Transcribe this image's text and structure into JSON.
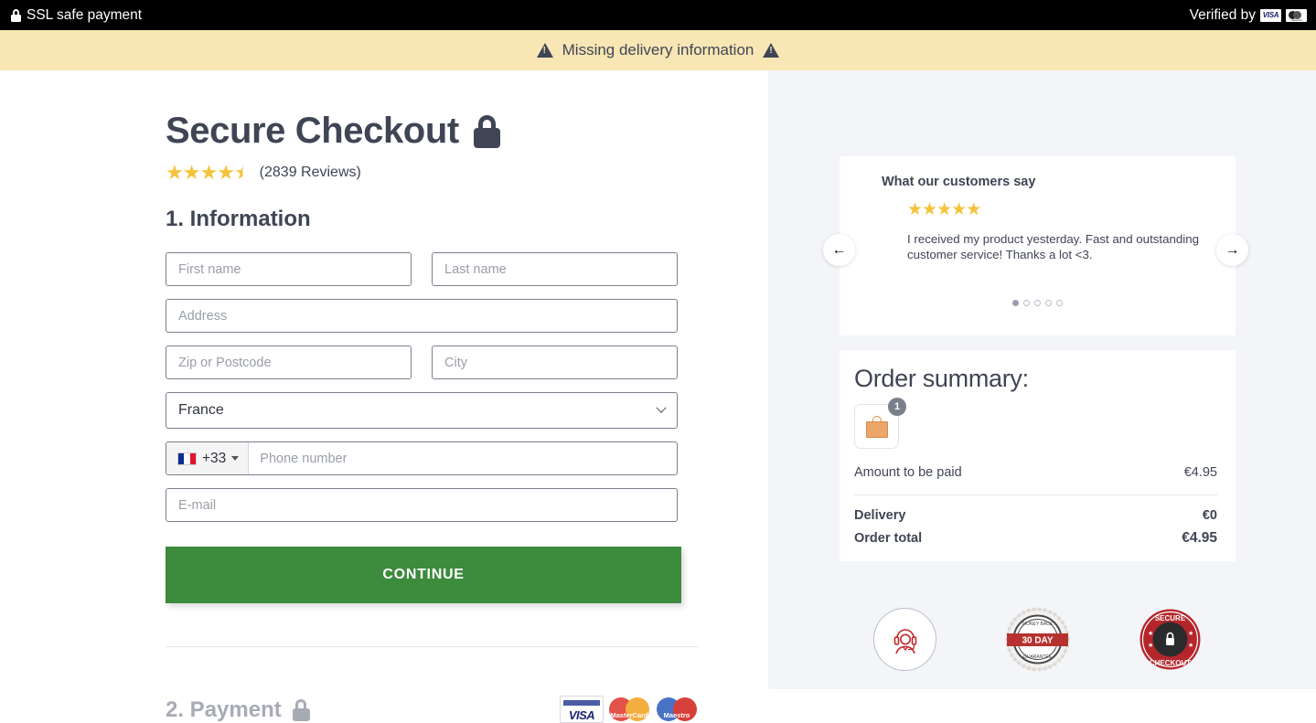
{
  "topbar": {
    "lock_icon": "lock-icon",
    "ssl_text": "SSL safe payment",
    "verified_text": "Verified by",
    "visa_label": "VISA",
    "mastercard_label": "mastercard"
  },
  "warning_banner": {
    "text": "Missing delivery information",
    "icon_left": "warning-triangle-icon",
    "icon_right": "warning-triangle-icon",
    "background_color": "#f8e6b4",
    "text_color": "#3f4554"
  },
  "checkout": {
    "title": "Secure Checkout",
    "title_icon": "lock-icon",
    "rating": {
      "value": 4.5,
      "max": 5,
      "star_color": "#f5c33b",
      "review_count_text": "(2839 Reviews)"
    },
    "step1_title": "1. Information",
    "step2_title": "2. Payment",
    "form": {
      "first_name_placeholder": "First name",
      "first_name_value": "",
      "last_name_placeholder": "Last name",
      "last_name_value": "",
      "address_placeholder": "Address",
      "address_value": "",
      "zip_placeholder": "Zip or Postcode",
      "zip_value": "",
      "city_placeholder": "City",
      "city_value": "",
      "country_selected": "France",
      "country_options": [
        "France"
      ],
      "phone_prefix": "+33",
      "phone_flag": "flag-france",
      "phone_placeholder": "Phone number",
      "phone_value": "",
      "email_placeholder": "E-mail",
      "email_value": ""
    },
    "continue_label": "CONTINUE",
    "continue_color": "#3d8b3d",
    "card_logos": [
      "VISA",
      "MasterCard",
      "Maestro"
    ]
  },
  "testimonial": {
    "heading": "What our customers say",
    "stars": 5,
    "text": "I received my product yesterday. Fast and outstanding customer service! Thanks a lot <3.",
    "prev_arrow": "←",
    "next_arrow": "→",
    "dot_count": 5,
    "active_dot": 1
  },
  "order_summary": {
    "title": "Order summary:",
    "item_icon": "shopping-bag-icon",
    "item_quantity": "1",
    "rows": [
      {
        "label": "Amount to be paid",
        "value": "€4.95",
        "bold": false
      },
      {
        "label": "Delivery",
        "value": "€0",
        "bold": true
      },
      {
        "label": "Order total",
        "value": "€4.95",
        "bold": true
      }
    ]
  },
  "trust_badges": [
    {
      "name": "customer-support-badge",
      "label": ""
    },
    {
      "name": "30-day-money-back-badge",
      "label": "30 DAY",
      "top_text": "MONEY BACK",
      "bottom_text": "GUARANTEE"
    },
    {
      "name": "secure-checkout-badge",
      "top_text": "SECURE",
      "bottom_text": "CHECKOUT"
    }
  ]
}
